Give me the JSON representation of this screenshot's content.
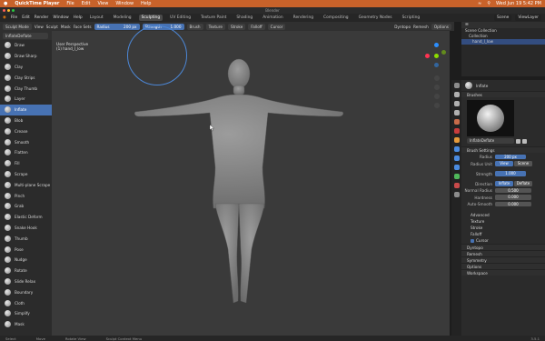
{
  "mac": {
    "app": "QuickTime Player",
    "menus": [
      "File",
      "Edit",
      "View",
      "Window",
      "Help"
    ],
    "clock": "Wed Jun 19  5:42 PM"
  },
  "window_title": "Blender",
  "blender": {
    "menus": [
      "File",
      "Edit",
      "Render",
      "Window",
      "Help"
    ],
    "workspaces": [
      "Layout",
      "Modeling",
      "Sculpting",
      "UV Editing",
      "Texture Paint",
      "Shading",
      "Animation",
      "Rendering",
      "Compositing",
      "Geometry Nodes",
      "Scripting"
    ],
    "active_workspace": "Sculpting",
    "scene": "Scene",
    "view_layer": "ViewLayer"
  },
  "header": {
    "mode": "Sculpt Mode",
    "menus": [
      "View",
      "Sculpt",
      "Mask",
      "Face Sets"
    ],
    "radius_label": "Radius",
    "radius_value": "200 px",
    "strength_label": "Strength",
    "strength_value": "1.000",
    "dropdowns": [
      "Brush",
      "Texture",
      "Stroke",
      "Falloff",
      "Cursor"
    ],
    "right": [
      "Dyntopo",
      "Remesh",
      "Options"
    ]
  },
  "brush_selector": "InflateDeflate",
  "tools": [
    "Draw",
    "Draw Sharp",
    "Clay",
    "Clay Strips",
    "Clay Thumb",
    "Layer",
    "Inflate",
    "Blob",
    "Crease",
    "Smooth",
    "Flatten",
    "Fill",
    "Scrape",
    "Multi-plane Scrape",
    "Pinch",
    "Grab",
    "Elastic Deform",
    "Snake Hook",
    "Thumb",
    "Pose",
    "Nudge",
    "Rotate",
    "Slide Relax",
    "Boundary",
    "Cloth",
    "Simplify",
    "Mask"
  ],
  "active_tool_index": 6,
  "viewport": {
    "line1": "User Perspective",
    "line2": "(1) hand_l_low"
  },
  "outliner": {
    "rows": [
      "Scene Collection",
      "Collection",
      "hand_l_low"
    ]
  },
  "properties": {
    "active_brush_label": "Inflate",
    "brushes_panel": "Brushes",
    "brush_name": "InflateDeflate",
    "settings_panel": "Brush Settings",
    "radius_label": "Radius",
    "radius_value": "200 px",
    "radius_unit_label": "Radius Unit",
    "unit_view": "View",
    "unit_scene": "Scene",
    "strength_label": "Strength",
    "strength_value": "1.000",
    "direction_label": "Direction",
    "dir_inflate": "Inflate",
    "dir_deflate": "Deflate",
    "normal_radius_label": "Normal Radius",
    "normal_radius_value": "0.500",
    "hardness_label": "Hardness",
    "hardness_value": "0.000",
    "autosmooth_label": "Auto-Smooth",
    "autosmooth_value": "0.000",
    "subpanels": [
      "Advanced",
      "Texture",
      "Stroke",
      "Falloff",
      "Cursor"
    ],
    "panels": [
      "Dyntopo",
      "Remesh",
      "Symmetry",
      "Options",
      "Workspace"
    ]
  },
  "status": {
    "items": [
      "Select",
      "Move",
      "Rotate View",
      "Sculpt Context Menu"
    ],
    "version": "3.5.1"
  },
  "colors": {
    "accent": "#4772b3",
    "mac_menubar": "#c8622a",
    "viewport_bg": "#3a3a3a"
  }
}
